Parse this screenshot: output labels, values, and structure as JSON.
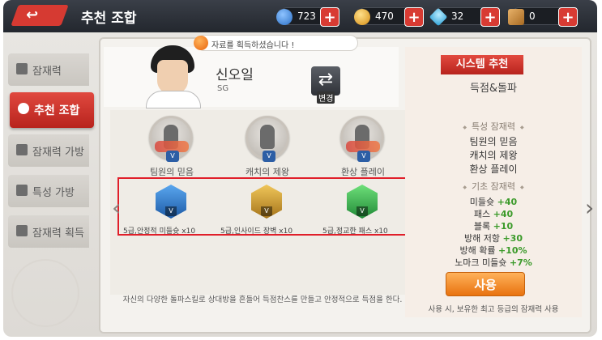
{
  "header": {
    "title": "추천 조합",
    "resources": [
      {
        "name": "blue-orb",
        "value": "723",
        "color": "#3a83d8"
      },
      {
        "name": "gold-coin",
        "value": "470",
        "color": "#e3a32b"
      },
      {
        "name": "diamond",
        "value": "32",
        "color": "#33b6e6"
      },
      {
        "name": "ticket",
        "value": "0",
        "color": "#c4893f"
      }
    ]
  },
  "sidebar": {
    "items": [
      {
        "label": "잠재력",
        "active": false
      },
      {
        "label": "추천 조합",
        "active": true
      },
      {
        "label": "잠재력 가방",
        "active": false
      },
      {
        "label": "특성 가방",
        "active": false
      },
      {
        "label": "잠재력 획득",
        "active": false
      }
    ]
  },
  "notice": "자료를 획득하셨습니다 !",
  "player": {
    "name": "신오일",
    "position": "SG",
    "change_label": "변경"
  },
  "potentials": [
    {
      "label": "팀원의 믿음",
      "tier": "V"
    },
    {
      "label": "캐치의 제왕",
      "tier": "V"
    },
    {
      "label": "환상 플레이",
      "tier": "V"
    }
  ],
  "highlighted_skills": [
    {
      "label": "5급,안정적 미들슛 x10",
      "tier": "V",
      "color": "#2d78c8"
    },
    {
      "label": "5급,인사이드 장벽 x10",
      "tier": "V",
      "color": "#c7952b"
    },
    {
      "label": "5급,정교한 패스 x10",
      "tier": "V",
      "color": "#2fa04a"
    }
  ],
  "description": "자신의 다양한 돌파스킬로 상대방을 흔들어 득점찬스를 만들고 안정적으로 득점을 한다.",
  "recommend": {
    "badge": "시스템 추천",
    "style": "득점&돌파",
    "trait_section": "특성 잠재력",
    "traits": [
      "팀원의 믿음",
      "캐치의 제왕",
      "환상 플레이"
    ],
    "base_section": "기초 잠재력",
    "stats": [
      {
        "name": "미들슛",
        "value": "+40"
      },
      {
        "name": "패스",
        "value": "+40"
      },
      {
        "name": "블록",
        "value": "+10"
      },
      {
        "name": "방해 저항",
        "value": "+30"
      },
      {
        "name": "방해 확률",
        "value": "+10%"
      },
      {
        "name": "노마크 미들슛",
        "value": "+7%"
      }
    ],
    "use_button": "사용",
    "use_note": "사용 시, 보유한 최고 등급의 잠재력 사용"
  }
}
